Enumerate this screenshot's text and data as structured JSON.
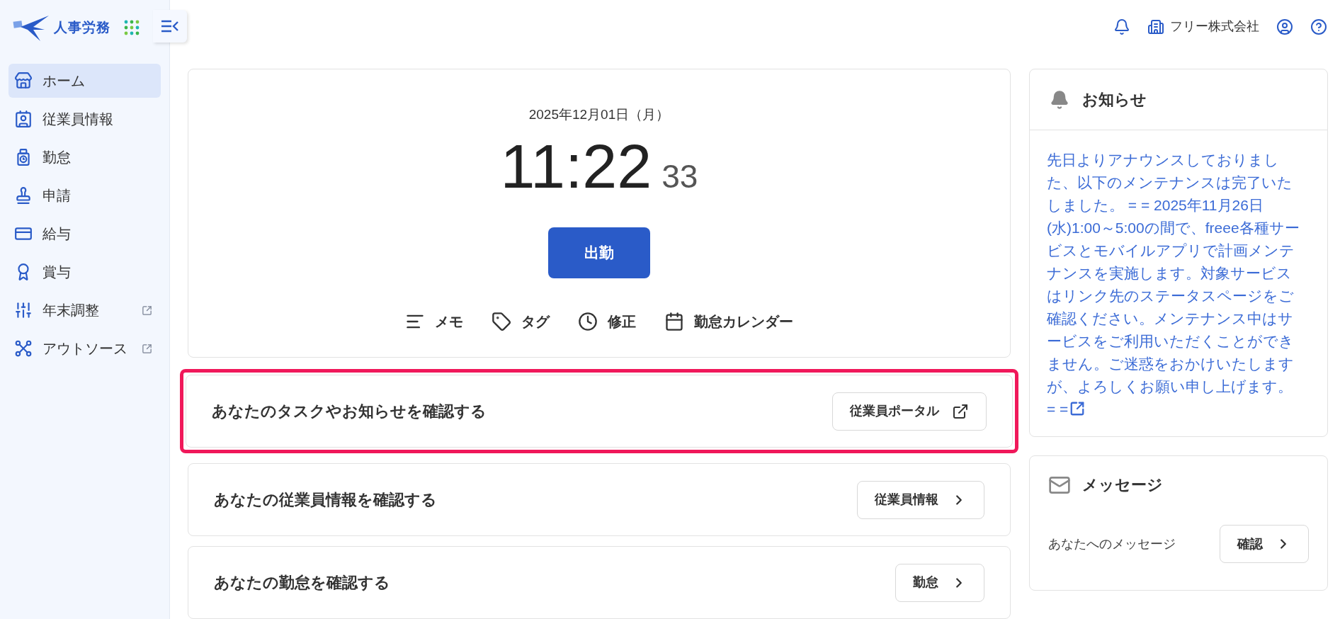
{
  "app": {
    "name": "人事労務"
  },
  "sidebar": {
    "items": [
      {
        "label": "ホーム",
        "kind": "home",
        "selected": true,
        "external": false
      },
      {
        "label": "従業員情報",
        "kind": "employee",
        "selected": false,
        "external": false
      },
      {
        "label": "勤怠",
        "kind": "attendance",
        "selected": false,
        "external": false
      },
      {
        "label": "申請",
        "kind": "stamp",
        "selected": false,
        "external": false
      },
      {
        "label": "給与",
        "kind": "salary",
        "selected": false,
        "external": false
      },
      {
        "label": "賞与",
        "kind": "bonus",
        "selected": false,
        "external": false
      },
      {
        "label": "年末調整",
        "kind": "adjust",
        "selected": false,
        "external": true
      },
      {
        "label": "アウトソース",
        "kind": "outsource",
        "selected": false,
        "external": true
      }
    ]
  },
  "header": {
    "company": "フリー株式会社"
  },
  "clock": {
    "date": "2025年12月01日（月）",
    "time": "11:22",
    "seconds": "33",
    "punch_button": "出勤",
    "actions": [
      {
        "label": "メモ",
        "kind": "memo"
      },
      {
        "label": "タグ",
        "kind": "tag"
      },
      {
        "label": "修正",
        "kind": "clock"
      },
      {
        "label": "勤怠カレンダー",
        "kind": "calendar"
      }
    ]
  },
  "cards": [
    {
      "text": "あなたのタスクやお知らせを確認する",
      "button": "従業員ポータル",
      "kind": "external",
      "highlighted": true
    },
    {
      "text": "あなたの従業員情報を確認する",
      "button": "従業員情報",
      "kind": "chevron",
      "highlighted": false
    },
    {
      "text": "あなたの勤怠を確認する",
      "button": "勤怠",
      "kind": "chevron",
      "highlighted": false
    }
  ],
  "notices": {
    "title": "お知らせ",
    "body": "先日よりアナウンスしておりました、以下のメンテナンスは完了いたしました。 = = 2025年11月26日(水)1:00～5:00の間で、freee各種サービスとモバイルアプリで計画メンテナンスを実施します。対象サービスはリンク先のステータスページをご確認ください。メンテナンス中はサービスをご利用いただくことができません。ご迷惑をおかけいたしますが、よろしくお願い申し上げます。 = ="
  },
  "messages": {
    "title": "メッセージ",
    "text": "あなたへのメッセージ",
    "button": "確認"
  }
}
